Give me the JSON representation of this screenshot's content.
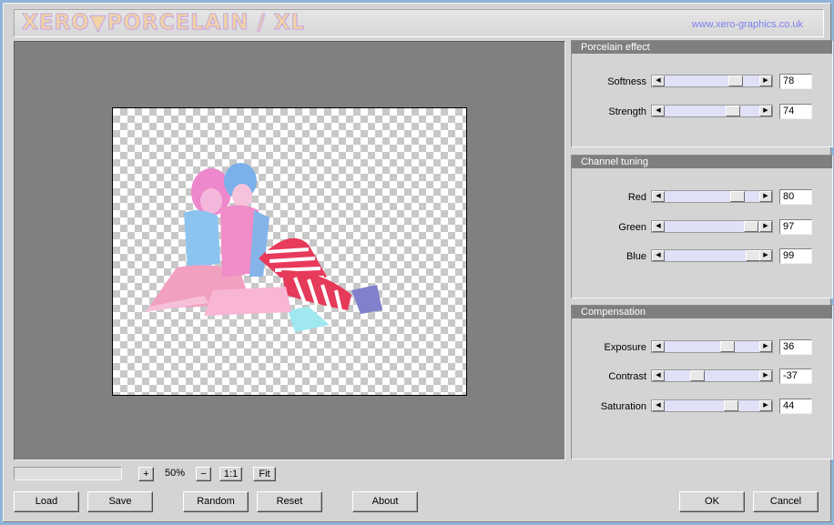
{
  "app": {
    "logo_text": "XERO▼PORCELAIN / XL",
    "url": "www.xero-graphics.co.uk"
  },
  "panels": [
    {
      "title": "Porcelain effect",
      "sliders": [
        {
          "label": "Softness",
          "value": "78",
          "pos": 0.78
        },
        {
          "label": "Strength",
          "value": "74",
          "pos": 0.74
        }
      ]
    },
    {
      "title": "Channel tuning",
      "sliders": [
        {
          "label": "Red",
          "value": "80",
          "pos": 0.8
        },
        {
          "label": "Green",
          "value": "97",
          "pos": 0.97
        },
        {
          "label": "Blue",
          "value": "99",
          "pos": 0.99
        }
      ]
    },
    {
      "title": "Compensation",
      "sliders": [
        {
          "label": "Exposure",
          "value": "36",
          "pos": 0.68
        },
        {
          "label": "Contrast",
          "value": "-37",
          "pos": 0.315
        },
        {
          "label": "Saturation",
          "value": "44",
          "pos": 0.72
        }
      ]
    }
  ],
  "zoom": {
    "plus_label": "+",
    "level": "50%",
    "minus_label": "−",
    "one_to_one_label": "1:1",
    "fit_label": "Fit"
  },
  "buttons": {
    "load": "Load",
    "save": "Save",
    "random": "Random",
    "reset": "Reset",
    "about": "About",
    "ok": "OK",
    "cancel": "Cancel"
  }
}
